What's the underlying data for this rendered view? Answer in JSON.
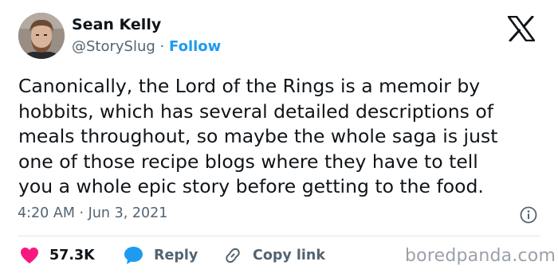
{
  "author": {
    "name": "Sean Kelly",
    "handle": "@StorySlug",
    "separator": "·",
    "follow_label": "Follow"
  },
  "tweet": {
    "lines": [
      "Canonically, the Lord of the Rings is a memoir by",
      "hobbits, which has several detailed descriptions of",
      "meals throughout, so maybe the whole saga is just",
      "one of those recipe blogs where they have to tell",
      "you a whole epic story before getting to the food."
    ],
    "time": "4:20 AM",
    "date_separator": "·",
    "date": "Jun 3, 2021"
  },
  "actions": {
    "likes": "57.3K",
    "reply_label": "Reply",
    "copy_label": "Copy link"
  },
  "watermark": "boredpanda.com",
  "icons": {
    "logo": "x-logo-icon",
    "info": "info-icon",
    "like": "heart-icon",
    "reply": "reply-bubble-icon",
    "copy": "link-icon"
  },
  "colors": {
    "follow": "#1d9bf0",
    "like": "#f91880",
    "reply": "#1d9bf0",
    "secondary_text": "#536471"
  }
}
